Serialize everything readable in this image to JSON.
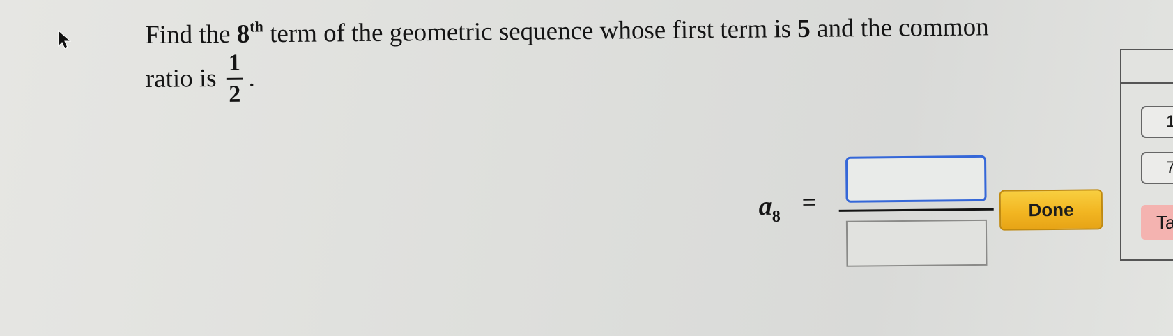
{
  "question": {
    "part1": "Find the ",
    "ordinal_num": "8",
    "ordinal_suffix": "th",
    "part2": " term of the geometric sequence whose first term is ",
    "first_term": "5",
    "part3": " and the common",
    "line2_text": "ratio is",
    "ratio_numerator": "1",
    "ratio_denominator": "2",
    "period": "."
  },
  "answer": {
    "variable": "a",
    "subscript": "8",
    "equals": "=",
    "numerator_value": "",
    "denominator_value": ""
  },
  "done_button": {
    "label": "Done"
  },
  "side_panel": {
    "key_1": "1",
    "key_7": "7",
    "tab_label": "Ta"
  },
  "colors": {
    "done_button": "#f2b622",
    "active_input_border": "#3567d8",
    "tab_background": "#f4b3b0"
  },
  "icons": {
    "cursor": "mouse-pointer-icon"
  }
}
